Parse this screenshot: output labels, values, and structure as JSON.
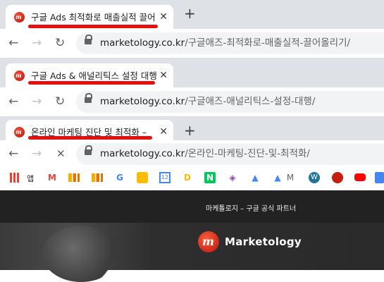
{
  "windows": [
    {
      "tab_title": "구글 Ads 최적화로 매출실적 끌어",
      "url_domain": "marketology.co.kr",
      "url_path": "/구글애즈-최적화로-매출실적-끌어올리기/",
      "reload_icon": "reload-icon"
    },
    {
      "tab_title": "구글 Ads & 애널리틱스 설정 대행",
      "url_domain": "marketology.co.kr",
      "url_path": "/구글애즈-애널리틱스-설정-대행/",
      "reload_icon": "reload-icon"
    },
    {
      "tab_title": "온라인 마케팅 진단 및 최적화 –",
      "url_domain": "marketology.co.kr",
      "url_path": "/온라인-마케팅-진단-및-최적화/",
      "reload_icon": "stop-icon"
    }
  ],
  "controls": {
    "close_glyph": "✕",
    "new_tab_glyph": "+",
    "back_glyph": "←",
    "forward_glyph": "→",
    "reload_glyph": "↻",
    "stop_glyph": "✕"
  },
  "bookmarks": {
    "apps_label": "앱",
    "items": [
      "gmail",
      "analytics",
      "analytics-2",
      "google",
      "keep",
      "calendar",
      "data-studio",
      "naver",
      "tag-manager",
      "google-ads",
      "google-ads-2",
      "m",
      "wordpress",
      "marketology",
      "youtube",
      "translate"
    ]
  },
  "site": {
    "topbar_text": "마케톨로지 – 구글 공식 파트너",
    "logo_text": "Marketology",
    "logo_glyph": "m"
  },
  "colors": {
    "annotation_red": "#e60f0f",
    "brand_red": "#c71d0e",
    "tab_strip": "#dee1e6"
  }
}
